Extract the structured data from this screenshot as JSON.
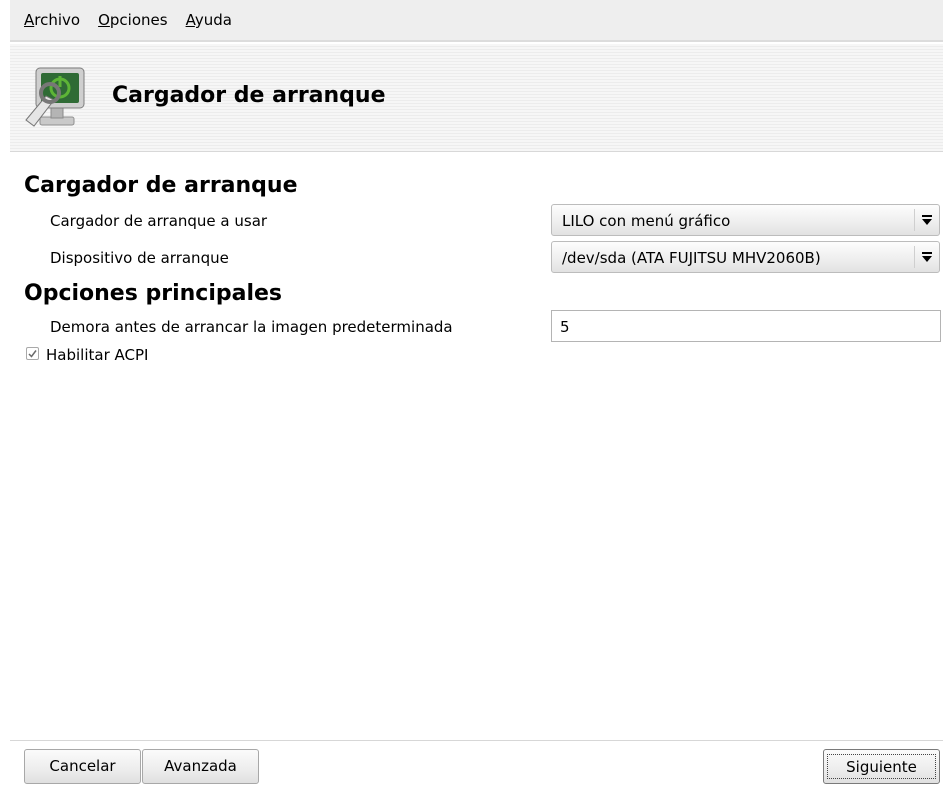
{
  "menubar": {
    "items": [
      {
        "mnemonic": "A",
        "rest": "rchivo"
      },
      {
        "mnemonic": "O",
        "rest": "pciones"
      },
      {
        "mnemonic": "A",
        "rest": "yuda"
      }
    ]
  },
  "header": {
    "title": "Cargador de arranque",
    "icon": "bootloader-power-monitor-icon"
  },
  "sections": {
    "bootloader": {
      "title": "Cargador de arranque",
      "loader_label": "Cargador de arranque a usar",
      "loader_value": "LILO con menú gráfico",
      "device_label": "Dispositivo de arranque",
      "device_value": "/dev/sda (ATA FUJITSU MHV2060B)"
    },
    "main_options": {
      "title": "Opciones principales",
      "delay_label": "Demora antes de arrancar la imagen predeterminada",
      "delay_value": "5",
      "acpi_label": "Habilitar ACPI",
      "acpi_checked": true
    }
  },
  "footer": {
    "cancel_label": "Cancelar",
    "advanced_label": "Avanzada",
    "next_label": "Siguiente"
  },
  "colors": {
    "menubar_bg": "#eeeeee",
    "accent": "#5db536",
    "icon_screen": "#2f6b35"
  }
}
